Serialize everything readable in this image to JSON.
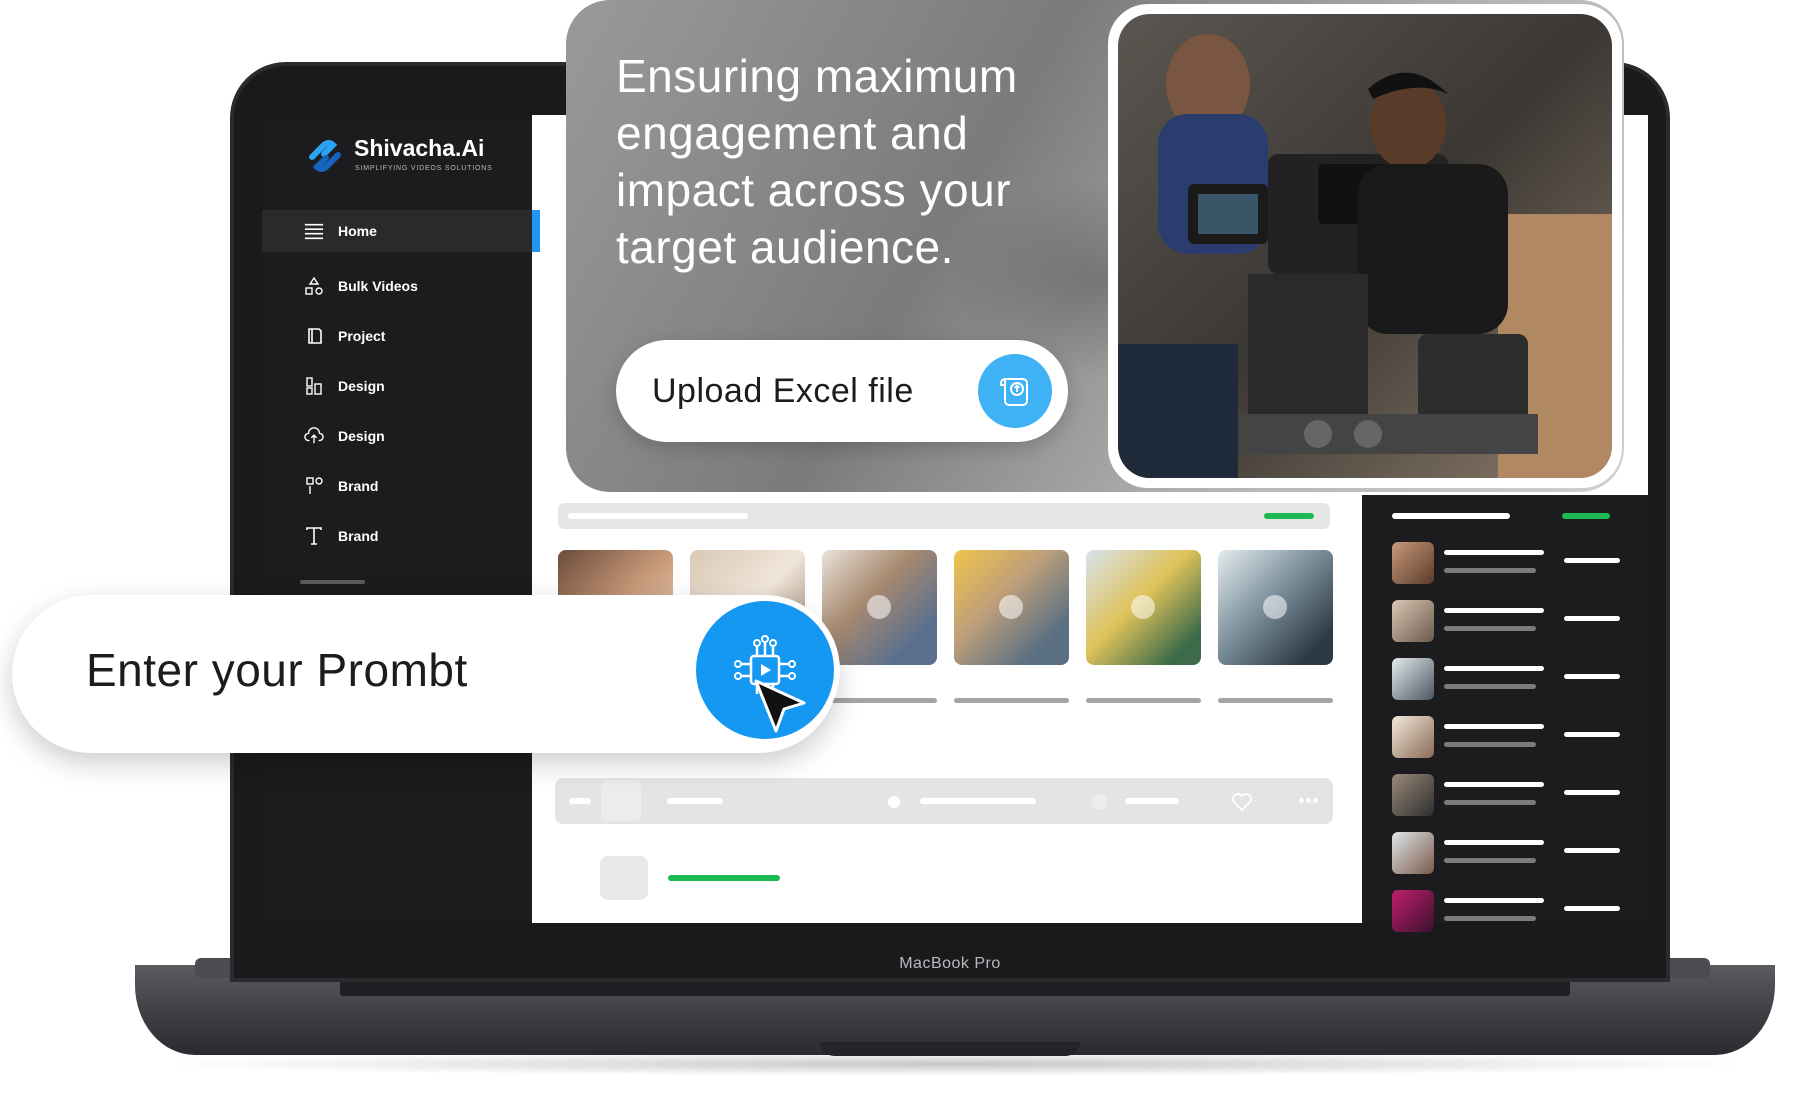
{
  "device": {
    "label": "MacBook Pro"
  },
  "app": {
    "name": "Shivacha.Ai",
    "tagline": "SIMPLIFYING VIDEOS SOLUTIONS"
  },
  "sidebar": {
    "items": [
      {
        "label": "Home",
        "icon": "menu-icon",
        "active": true
      },
      {
        "label": "Bulk Videos",
        "icon": "shapes-icon"
      },
      {
        "label": "Project",
        "icon": "cube-icon"
      },
      {
        "label": "Design",
        "icon": "layout-icon"
      },
      {
        "label": "Design",
        "icon": "cloud-upload-icon"
      },
      {
        "label": "Brand",
        "icon": "brand-icon"
      },
      {
        "label": "Brand",
        "icon": "text-icon"
      }
    ]
  },
  "hero": {
    "headline": "Ensuring maximum engagement and impact across your target audience.",
    "upload_label": "Upload Excel file"
  },
  "prompt": {
    "label": "Enter your Prombt"
  },
  "colors": {
    "accent": "#2196f3",
    "green": "#1db954",
    "dark": "#1c1c1e"
  }
}
